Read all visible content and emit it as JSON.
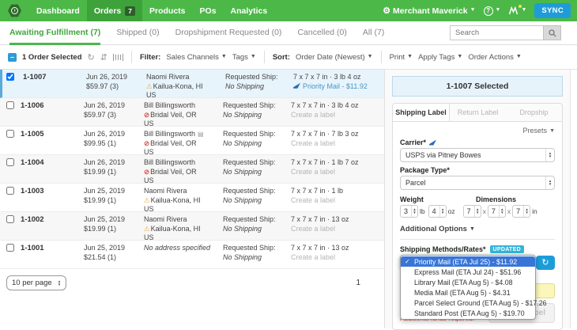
{
  "colors": {
    "brand_green": "#4cb848",
    "accent_blue": "#1e9cd8",
    "selection_blue": "#3875d7",
    "warning_orange": "#f0ad4e",
    "error_red": "#d9534f",
    "alert_red": "#c0392b",
    "updated_badge": "#35b4d9"
  },
  "nav": {
    "items": [
      {
        "label": "Dashboard"
      },
      {
        "label": "Orders",
        "badge": "7"
      },
      {
        "label": "Products"
      },
      {
        "label": "POs"
      },
      {
        "label": "Analytics"
      }
    ],
    "account_label": "Merchant Maverick",
    "help_label": "?",
    "sync_label": "SYNC"
  },
  "tabs": {
    "items": [
      {
        "label": "Awaiting Fulfillment (7)"
      },
      {
        "label": "Shipped (0)"
      },
      {
        "label": "Dropshipment Requested (0)"
      },
      {
        "label": "Cancelled (0)"
      },
      {
        "label": "All (7)"
      }
    ],
    "search_placeholder": "Search"
  },
  "toolbar": {
    "selected_text": "1 Order Selected",
    "filter_label": "Filter:",
    "filters": [
      "Sales Channels",
      "Tags"
    ],
    "sort_label": "Sort:",
    "sort_value": "Order Date (Newest)",
    "actions": [
      "Print",
      "Apply Tags",
      "Order Actions"
    ]
  },
  "orders": {
    "rows": [
      {
        "id": "1-1007",
        "date": "Jun 26, 2019",
        "total": "$59.97 (3)",
        "name": "Naomi Rivera",
        "location": "Kailua-Kona, HI",
        "country": "US",
        "requested_label": "Requested Ship:",
        "requested_value": "No Shipping",
        "dims": "7 x 7 x 7 in · 3 lb 4 oz",
        "method": "Priority Mail - $11.92"
      },
      {
        "id": "1-1006",
        "date": "Jun 26, 2019",
        "total": "$59.97 (3)",
        "name": "Bill Billingsworth",
        "location": "Bridal Veil, OR",
        "country": "US",
        "requested_label": "Requested Ship:",
        "requested_value": "No Shipping",
        "dims": "7 x 7 x 7 in · 3 lb 4 oz",
        "method": "Create a label"
      },
      {
        "id": "1-1005",
        "date": "Jun 26, 2019",
        "total": "$99.95 (1)",
        "name": "Bill Billingsworth",
        "location": "Bridal Veil, OR",
        "country": "US",
        "requested_label": "Requested Ship:",
        "requested_value": "No Shipping",
        "dims": "7 x 7 x 7 in · 7 lb 3 oz",
        "method": "Create a label"
      },
      {
        "id": "1-1004",
        "date": "Jun 26, 2019",
        "total": "$19.99 (1)",
        "name": "Bill Billingsworth",
        "location": "Bridal Veil, OR",
        "country": "US",
        "requested_label": "Requested Ship:",
        "requested_value": "No Shipping",
        "dims": "7 x 7 x 7 in · 1 lb 7 oz",
        "method": "Create a label"
      },
      {
        "id": "1-1003",
        "date": "Jun 25, 2019",
        "total": "$19.99 (1)",
        "name": "Naomi Rivera",
        "location": "Kailua-Kona, HI",
        "country": "US",
        "requested_label": "Requested Ship:",
        "requested_value": "No Shipping",
        "dims": "7 x 7 x 7 in · 1 lb",
        "method": "Create a label"
      },
      {
        "id": "1-1002",
        "date": "Jun 25, 2019",
        "total": "$19.99 (1)",
        "name": "Naomi Rivera",
        "location": "Kailua-Kona, HI",
        "country": "US",
        "requested_label": "Requested Ship:",
        "requested_value": "No Shipping",
        "dims": "7 x 7 x 7 in · 13 oz",
        "method": "Create a label"
      },
      {
        "id": "1-1001",
        "date": "Jun 25, 2019",
        "total": "$21.54 (1)",
        "name": "No address specified",
        "location": "",
        "country": "",
        "requested_label": "Requested Ship:",
        "requested_value": "No Shipping",
        "dims": "7 x 7 x 7 in · 13 oz",
        "method": "Create a label"
      }
    ]
  },
  "pagination": {
    "per_page": "10 per page",
    "page": "1"
  },
  "panel": {
    "banner": "1-1007 Selected",
    "tabs": [
      "Shipping Label",
      "Return Label",
      "Dropship"
    ],
    "presets": "Presets",
    "carrier_label": "Carrier*",
    "carrier_value": "USPS via Pitney Bowes",
    "package_label": "Package Type*",
    "package_value": "Parcel",
    "weight_label": "Weight",
    "weight_lb": "3",
    "lb_unit": "lb",
    "weight_oz": "4",
    "oz_unit": "oz",
    "dimensions_label": "Dimensions",
    "dim_l": "7",
    "dim_w": "7",
    "dim_h": "7",
    "x_sep": "x",
    "in_unit": "in",
    "additional_options": "Additional Options",
    "rates_label": "Shipping Methods/Rates*",
    "updated_badge": "UPDATED",
    "rate_options": [
      "Priority Mail (ETA Jul 25) - $11.92",
      "Express Mail (ETA Jul 24) - $51.96",
      "Library Mail (ETA Aug 5) - $4.08",
      "Media Mail (ETA Aug 5) - $4.31",
      "Parcel Select Ground (ETA Aug 5) - $17.26",
      "Standard Post (ETA Aug 5) - $19.70"
    ],
    "cost_fragment": ")",
    "create_label_button": "Create Label",
    "funds_warning": "Additional funds required."
  }
}
